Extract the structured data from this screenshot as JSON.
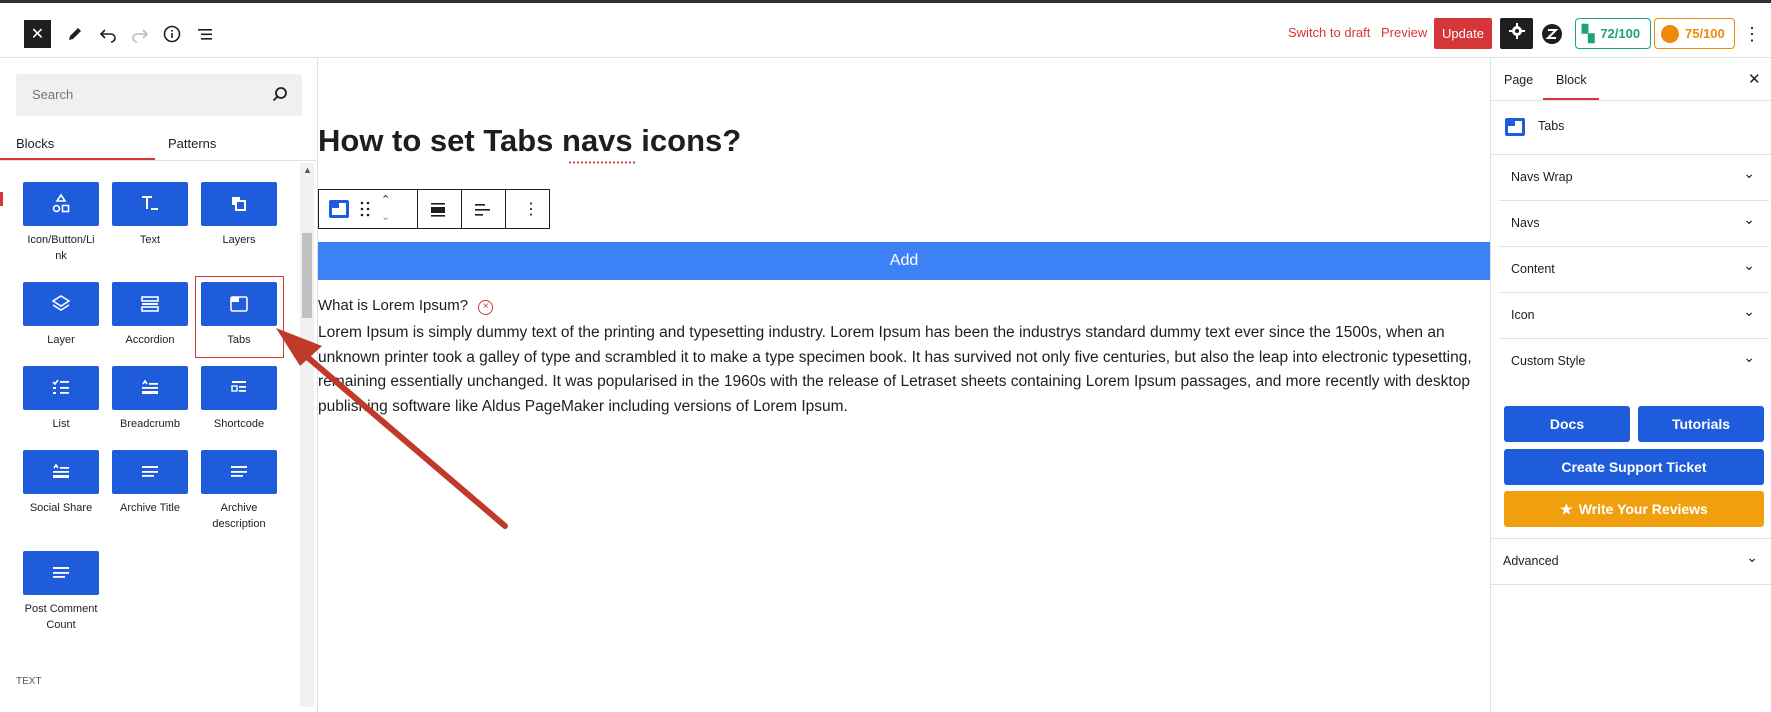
{
  "topbar": {
    "switch_to_draft": "Switch to draft",
    "preview": "Preview",
    "update": "Update",
    "score1": "72/100",
    "score2": "75/100",
    "colors": {
      "update": "#d63638",
      "score1": "#1fa37a",
      "score2": "#f0880a"
    }
  },
  "left": {
    "search_placeholder": "Search",
    "tabs": [
      "Blocks",
      "Patterns"
    ],
    "blocks": [
      {
        "label": "Icon/Button/Li nk",
        "icon": "shapes-icon"
      },
      {
        "label": "Text",
        "icon": "text-icon"
      },
      {
        "label": "Layers",
        "icon": "layers-icon"
      },
      {
        "label": "Layer",
        "icon": "layer-icon"
      },
      {
        "label": "Accordion",
        "icon": "accordion-icon"
      },
      {
        "label": "Tabs",
        "icon": "tabs-icon"
      },
      {
        "label": "List",
        "icon": "list-icon"
      },
      {
        "label": "Breadcrumb",
        "icon": "breadcrumb-icon"
      },
      {
        "label": "Shortcode",
        "icon": "shortcode-icon"
      },
      {
        "label": "Social Share",
        "icon": "social-share-icon"
      },
      {
        "label": "Archive Title",
        "icon": "archive-title-icon"
      },
      {
        "label": "Archive description",
        "icon": "archive-description-icon"
      },
      {
        "label": "Post Comment Count",
        "icon": "comment-count-icon"
      }
    ],
    "section_label": "TEXT"
  },
  "main": {
    "title": "How to set Tabs navs icons?",
    "add_label": "Add",
    "question": "What is Lorem Ipsum?",
    "paragraph": "Lorem Ipsum is simply dummy text of the printing and typesetting industry. Lorem Ipsum has been the industrys standard dummy text ever since the 1500s, when an unknown printer took a galley of type and scrambled it to make a type specimen book. It has survived not only five centuries, but also the leap into electronic typesetting, remaining essentially unchanged. It was popularised in the 1960s with the release of Letraset sheets containing Lorem Ipsum passages, and more recently with desktop publishing software like Aldus PageMaker including versions of Lorem Ipsum."
  },
  "right": {
    "tabs": [
      "Page",
      "Block"
    ],
    "block_name": "Tabs",
    "sections": [
      "Navs Wrap",
      "Navs",
      "Content",
      "Icon",
      "Custom Style"
    ],
    "docs": "Docs",
    "tutorials": "Tutorials",
    "support": "Create Support Ticket",
    "reviews": "Write Your Reviews",
    "advanced": "Advanced",
    "colors": {
      "button_blue": "#1e5cdb",
      "review_orange": "#f0a00f"
    }
  }
}
